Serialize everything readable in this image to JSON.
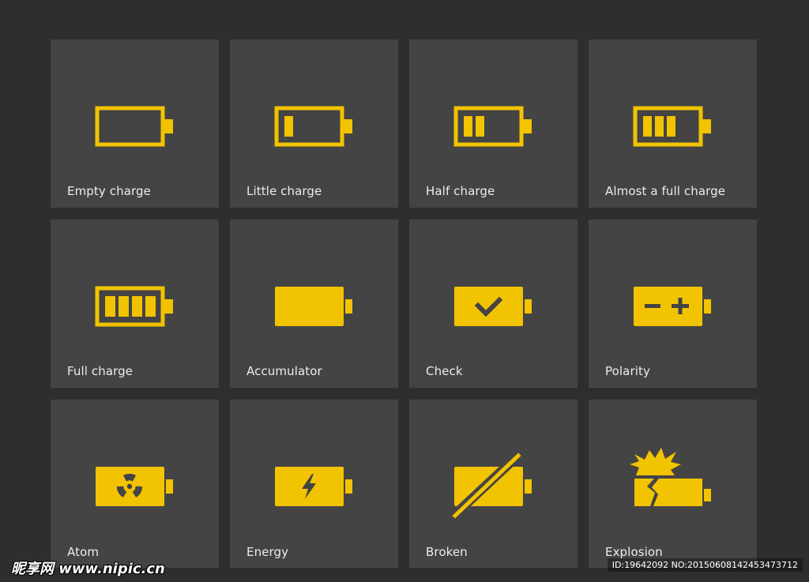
{
  "colors": {
    "background": "#2e2e2e",
    "tile": "#444444",
    "accent": "#f2c300",
    "label": "#ececec"
  },
  "tiles": [
    {
      "label": "Empty charge",
      "icon": "battery-empty-icon",
      "level": 0
    },
    {
      "label": "Little charge",
      "icon": "battery-little-icon",
      "level": 1
    },
    {
      "label": "Half charge",
      "icon": "battery-half-icon",
      "level": 2
    },
    {
      "label": "Almost a full charge",
      "icon": "battery-almost-full-icon",
      "level": 3
    },
    {
      "label": "Full charge",
      "icon": "battery-full-icon",
      "level": 4
    },
    {
      "label": "Accumulator",
      "icon": "battery-accumulator-icon"
    },
    {
      "label": "Check",
      "icon": "battery-check-icon"
    },
    {
      "label": "Polarity",
      "icon": "battery-polarity-icon"
    },
    {
      "label": "Atom",
      "icon": "battery-atom-icon"
    },
    {
      "label": "Energy",
      "icon": "battery-energy-icon"
    },
    {
      "label": "Broken",
      "icon": "battery-broken-icon"
    },
    {
      "label": "Explosion",
      "icon": "battery-explosion-icon"
    }
  ],
  "watermark": {
    "left": "昵享网 www.nipic.cn",
    "right": "ID:19642092 NO:20150608142453473712"
  }
}
